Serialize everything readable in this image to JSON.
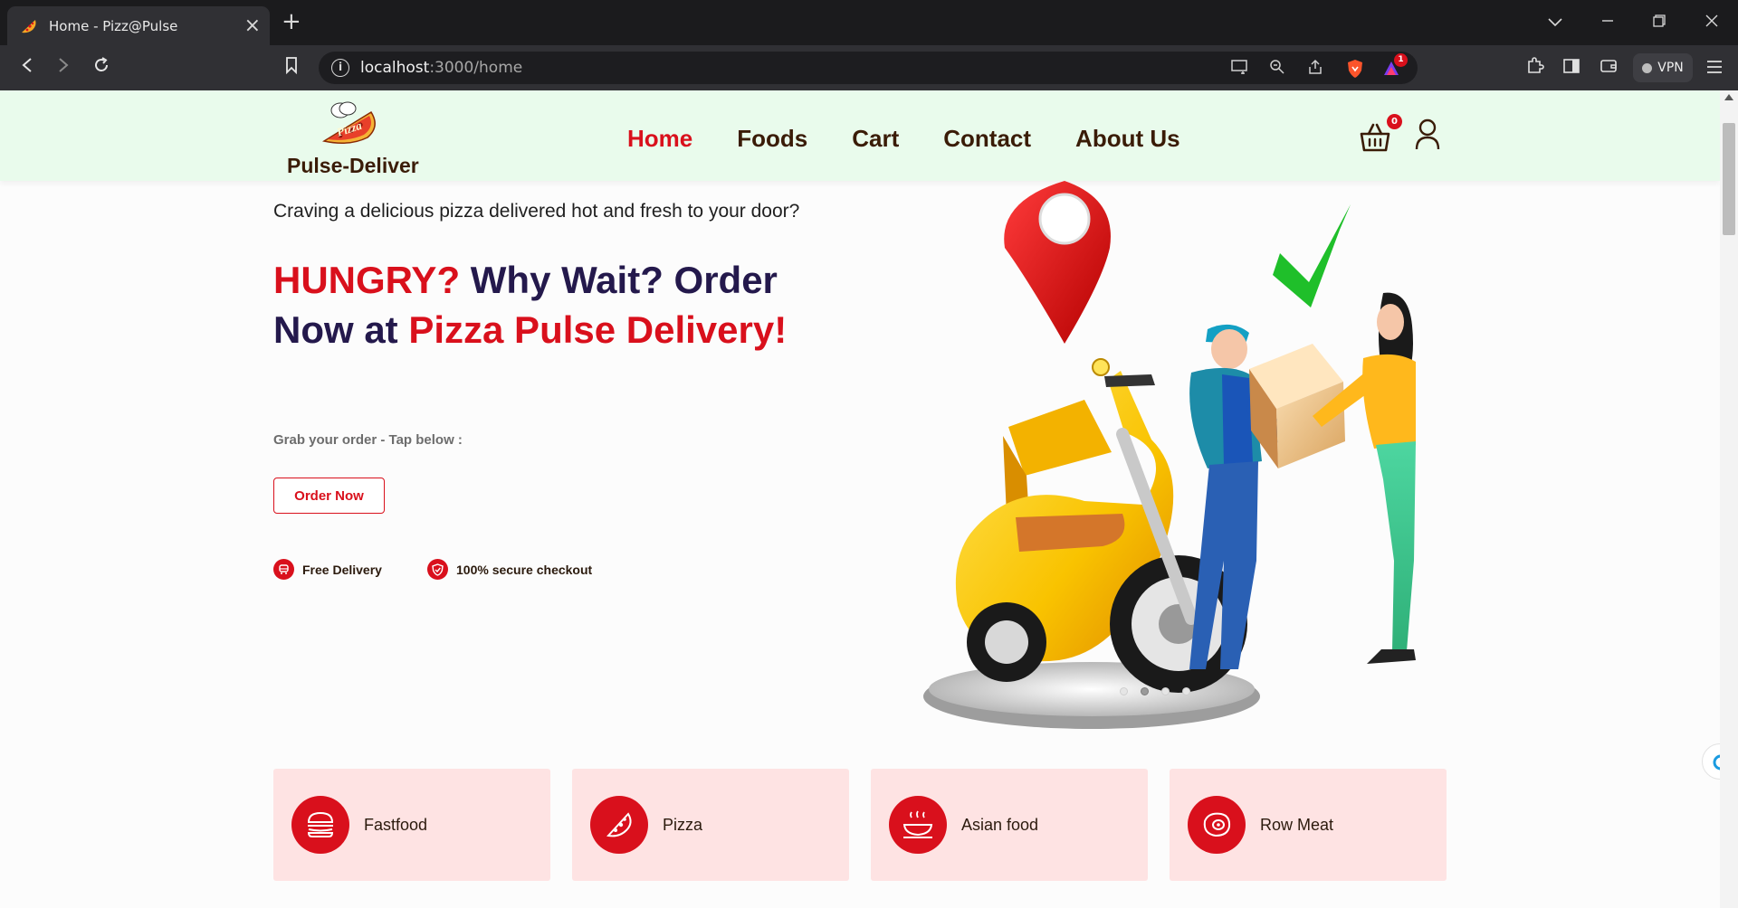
{
  "browser": {
    "tab_title": "Home - Pizz@Pulse",
    "new_tab_symbol": "+",
    "close_symbol": "×",
    "url_host": "localhost",
    "url_path": ":3000/home",
    "vpn_label": "VPN",
    "notification_count": "1"
  },
  "header": {
    "logo_text": "Pulse-Deliver",
    "nav": [
      {
        "label": "Home",
        "active": true
      },
      {
        "label": "Foods",
        "active": false
      },
      {
        "label": "Cart",
        "active": false
      },
      {
        "label": "Contact",
        "active": false
      },
      {
        "label": "About Us",
        "active": false
      }
    ],
    "cart_count": "0"
  },
  "hero": {
    "tagline": "Craving a delicious pizza delivered hot and fresh to your door?",
    "title_parts": {
      "p1": "HUNGRY?",
      "p2": " Why Wait? Order Now at ",
      "p3": "Pizza Pulse Delivery!"
    },
    "subtitle": "Grab your order - Tap below :",
    "order_button": "Order Now",
    "features": [
      {
        "label": "Free Delivery",
        "icon": "car-icon"
      },
      {
        "label": "100% secure checkout",
        "icon": "shield-check-icon"
      }
    ],
    "carousel_slides": 4,
    "carousel_active": 2
  },
  "categories": [
    {
      "label": "Fastfood",
      "icon": "burger-icon"
    },
    {
      "label": "Pizza",
      "icon": "pizza-slice-icon"
    },
    {
      "label": "Asian food",
      "icon": "hot-dish-icon"
    },
    {
      "label": "Row Meat",
      "icon": "steak-icon"
    }
  ],
  "colors": {
    "accent_red": "#d9101c",
    "header_bg": "#e9fbec",
    "navy": "#24194c",
    "brown_text": "#3a1c07",
    "category_bg": "#fee3e3"
  }
}
